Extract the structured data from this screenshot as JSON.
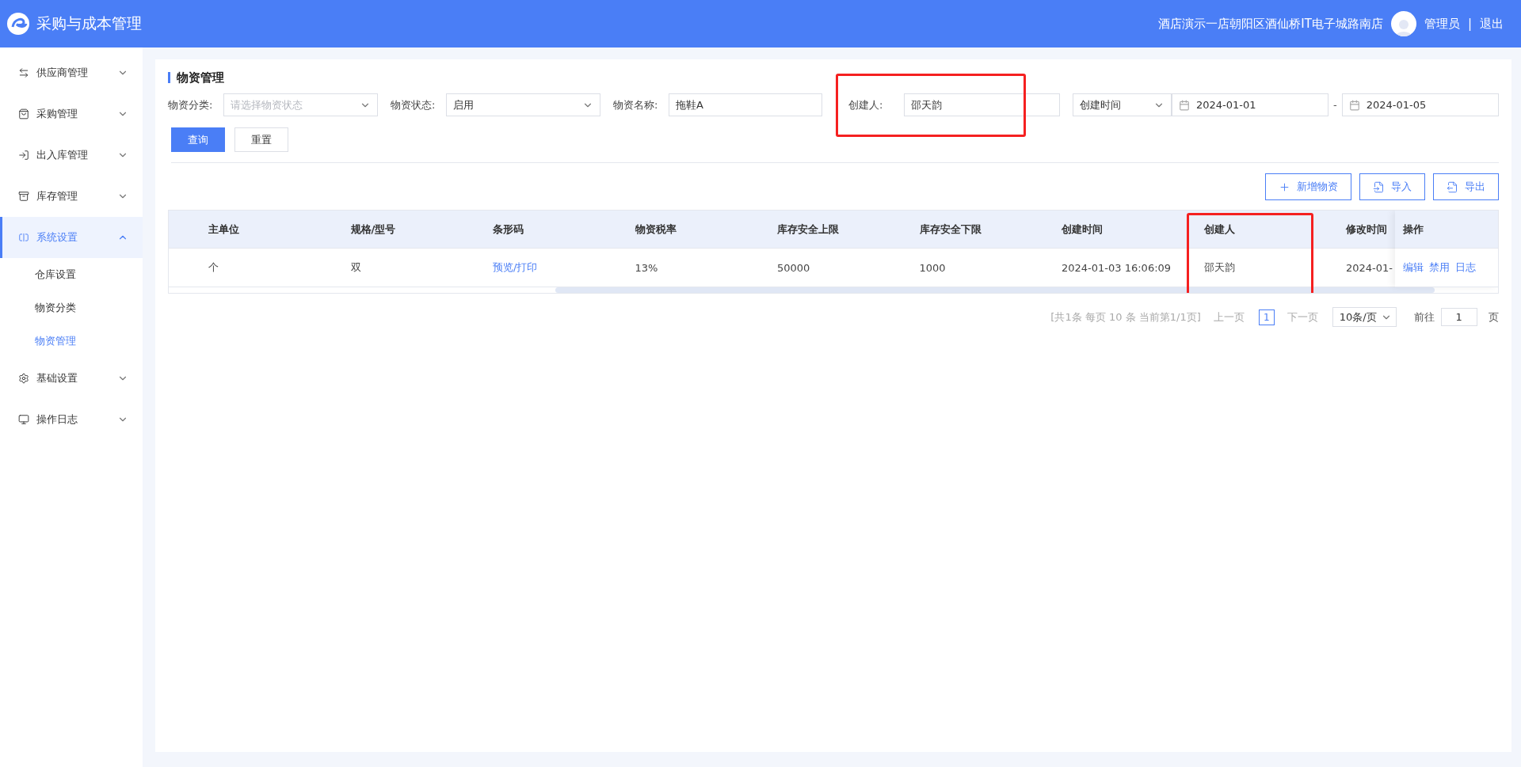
{
  "header": {
    "app_title": "采购与成本管理",
    "store": "酒店演示一店朝阳区酒仙桥IT电子城路南店",
    "user": "管理员",
    "separator": "|",
    "logout": "退出"
  },
  "sidebar": {
    "items": [
      {
        "label": "供应商管理",
        "expanded": false,
        "selected": false
      },
      {
        "label": "采购管理",
        "expanded": false,
        "selected": false
      },
      {
        "label": "出入库管理",
        "expanded": false,
        "selected": false
      },
      {
        "label": "库存管理",
        "expanded": false,
        "selected": false
      },
      {
        "label": "系统设置",
        "expanded": true,
        "selected": true,
        "children": [
          {
            "label": "仓库设置",
            "selected": false
          },
          {
            "label": "物资分类",
            "selected": false
          },
          {
            "label": "物资管理",
            "selected": true
          }
        ]
      },
      {
        "label": "基础设置",
        "expanded": false,
        "selected": false
      },
      {
        "label": "操作日志",
        "expanded": false,
        "selected": false
      }
    ]
  },
  "page_title": "物资管理",
  "filters": [
    {
      "kind": "select",
      "label": "物资分类:",
      "placeholder": "请选择物资状态",
      "highlighted": false
    },
    {
      "kind": "select",
      "label": "物资状态:",
      "value": "启用",
      "highlighted": false
    },
    {
      "kind": "text",
      "label": "物资名称:",
      "value": "拖鞋A",
      "highlighted": false
    },
    {
      "kind": "text",
      "label": "创建人:",
      "value": "邵天韵",
      "highlighted": true
    },
    {
      "kind": "daterange",
      "field": "创建时间",
      "start": "2024-01-01",
      "separator": "-",
      "end": "2024-01-05",
      "highlighted": false
    }
  ],
  "query_buttons": [
    {
      "label": "查询",
      "kind": "primary"
    },
    {
      "label": "重置",
      "kind": "default"
    }
  ],
  "actions": [
    {
      "label": "新增物资"
    },
    {
      "label": "导入"
    },
    {
      "label": "导出"
    }
  ],
  "table": {
    "columns": [
      {
        "label": "主单位",
        "highlighted": false
      },
      {
        "label": "规格/型号",
        "highlighted": false
      },
      {
        "label": "条形码",
        "highlighted": false
      },
      {
        "label": "物资税率",
        "highlighted": false
      },
      {
        "label": "库存安全上限",
        "highlighted": false
      },
      {
        "label": "库存安全下限",
        "highlighted": false
      },
      {
        "label": "创建时间",
        "highlighted": false
      },
      {
        "label": "创建人",
        "highlighted": true
      },
      {
        "label": "修改时间",
        "highlighted": false
      }
    ],
    "rows": [
      {
        "cells": [
          {
            "text": "个",
            "kind": "text"
          },
          {
            "text": "双",
            "kind": "text"
          },
          {
            "text": "预览/打印",
            "kind": "link"
          },
          {
            "text": "13%",
            "kind": "text"
          },
          {
            "text": "50000",
            "kind": "text"
          },
          {
            "text": "1000",
            "kind": "text"
          },
          {
            "text": "2024-01-03 16:06:09",
            "kind": "text"
          },
          {
            "text": "邵天韵",
            "kind": "text"
          },
          {
            "text": "2024-01-",
            "kind": "text"
          }
        ],
        "operations": [
          "编辑",
          "禁用",
          "日志"
        ]
      }
    ],
    "operation_column": "操作"
  },
  "pagination": {
    "summary": "[共1条 每页 10 条 当前第1/1页]",
    "prev": "上一页",
    "pages": [
      {
        "label": "1",
        "selected": true
      }
    ],
    "next": "下一页",
    "page_size": "10条/页",
    "goto_label": "前往",
    "goto_value": "1",
    "goto_suffix": "页"
  }
}
